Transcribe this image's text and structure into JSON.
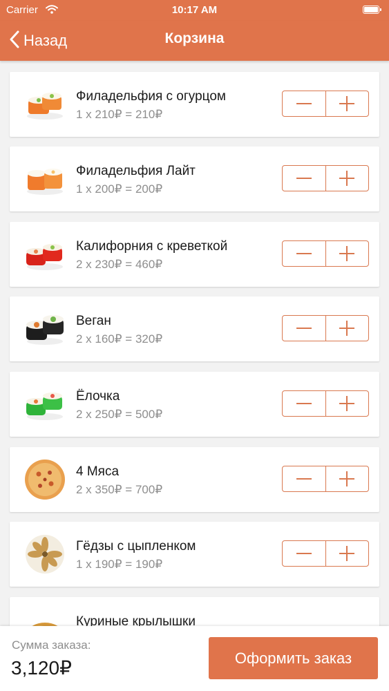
{
  "status_bar": {
    "carrier": "Carrier",
    "time": "10:17 AM"
  },
  "nav": {
    "back_label": "Назад",
    "title": "Корзина"
  },
  "items": [
    {
      "name": "Филадельфия с огурцом",
      "price_line": "1 x 210₽ = 210₽",
      "image_icon": "sushi-roll-orange-icon"
    },
    {
      "name": "Филадельфия Лайт",
      "price_line": "1 x 200₽ = 200₽",
      "image_icon": "sushi-roll-orange-icon"
    },
    {
      "name": "Калифорния с креветкой",
      "price_line": "2 x 230₽ = 460₽",
      "image_icon": "sushi-roll-red-icon"
    },
    {
      "name": "Веган",
      "price_line": "2 x 160₽ = 320₽",
      "image_icon": "maki-roll-icon"
    },
    {
      "name": "Ёлочка",
      "price_line": "2 x 250₽ = 500₽",
      "image_icon": "sushi-roll-green-icon"
    },
    {
      "name": "4 Мяса",
      "price_line": "2 x 350₽ = 700₽",
      "image_icon": "pizza-icon"
    },
    {
      "name": "Гёдзы с цыпленком",
      "price_line": "1 x 190₽ = 190₽",
      "image_icon": "gyoza-plate-icon"
    },
    {
      "name": "Куриные крылышки",
      "price_line": "",
      "image_icon": "chicken-wings-icon"
    }
  ],
  "footer": {
    "sum_label": "Сумма заказа:",
    "sum_value": "3,120₽",
    "checkout_label": "Оформить заказ"
  },
  "colors": {
    "accent": "#e0744b",
    "stepper_border": "#d9784f",
    "price_text": "#8e8e8e",
    "background": "#f2f2f2"
  }
}
